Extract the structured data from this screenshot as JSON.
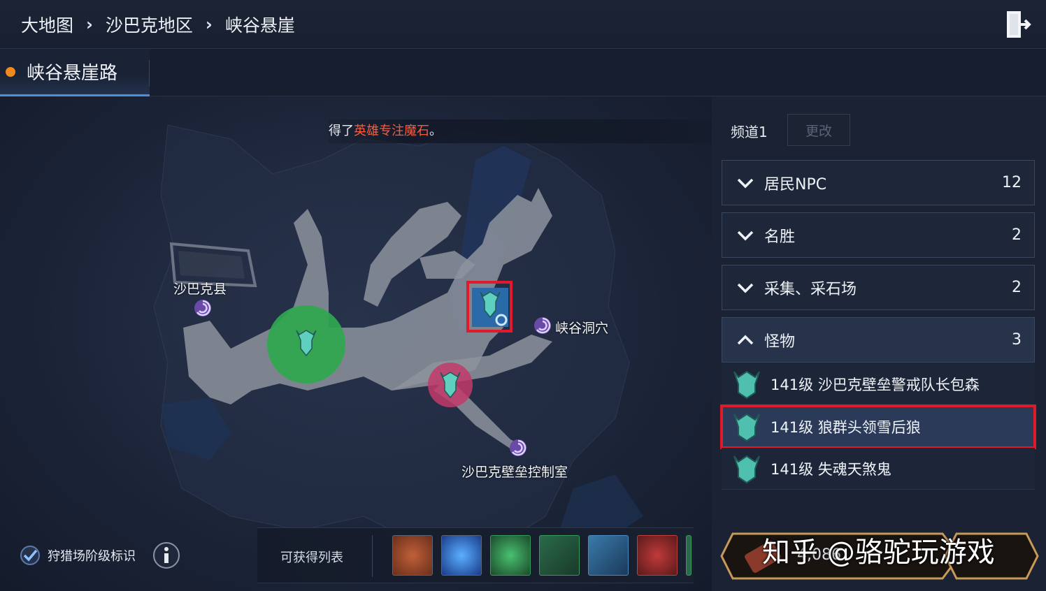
{
  "breadcrumb": [
    "大地图",
    "沙巴克地区",
    "峡谷悬崖"
  ],
  "breadcrumb_sep": "›",
  "subtab": {
    "label": "峡谷悬崖路"
  },
  "notice": {
    "prefix": "得了",
    "highlight": "英雄专注魔石",
    "suffix": "。"
  },
  "map_labels": {
    "town": "沙巴克县",
    "cave": "峡谷洞穴",
    "control_room": "沙巴克壁垒控制室"
  },
  "channel": {
    "label": "频道1",
    "change_button": "更改"
  },
  "categories": [
    {
      "name": "居民NPC",
      "count": "12",
      "open": false
    },
    {
      "name": "名胜",
      "count": "2",
      "open": false
    },
    {
      "name": "采集、采石场",
      "count": "2",
      "open": false
    },
    {
      "name": "怪物",
      "count": "3",
      "open": true
    }
  ],
  "monsters": [
    {
      "name": "141级 沙巴克壁垒警戒队长包森",
      "selected": false
    },
    {
      "name": "141级 狼群头领雪后狼",
      "selected": true
    },
    {
      "name": "141级 失魂天煞鬼",
      "selected": false
    }
  ],
  "bottom": {
    "hunt_grade_label": "狩猎场阶级标识",
    "hunt_grade_checked": true,
    "drop_list_label": "可获得列表",
    "teleport_cost": "4,086",
    "watermark": "知乎 @骆驼玩游戏"
  },
  "colors": {
    "accent_orange": "#f08a1c",
    "highlight_red": "#ff5a3a",
    "selection_red": "#e01a2a",
    "zone_green": "#2fa84f",
    "zone_pink": "#c23a6a"
  },
  "icons": {
    "exit": "exit-door-icon",
    "info": "info-icon",
    "check": "check-icon",
    "portal": "portal-swirl-icon",
    "monster": "monster-head-icon"
  }
}
